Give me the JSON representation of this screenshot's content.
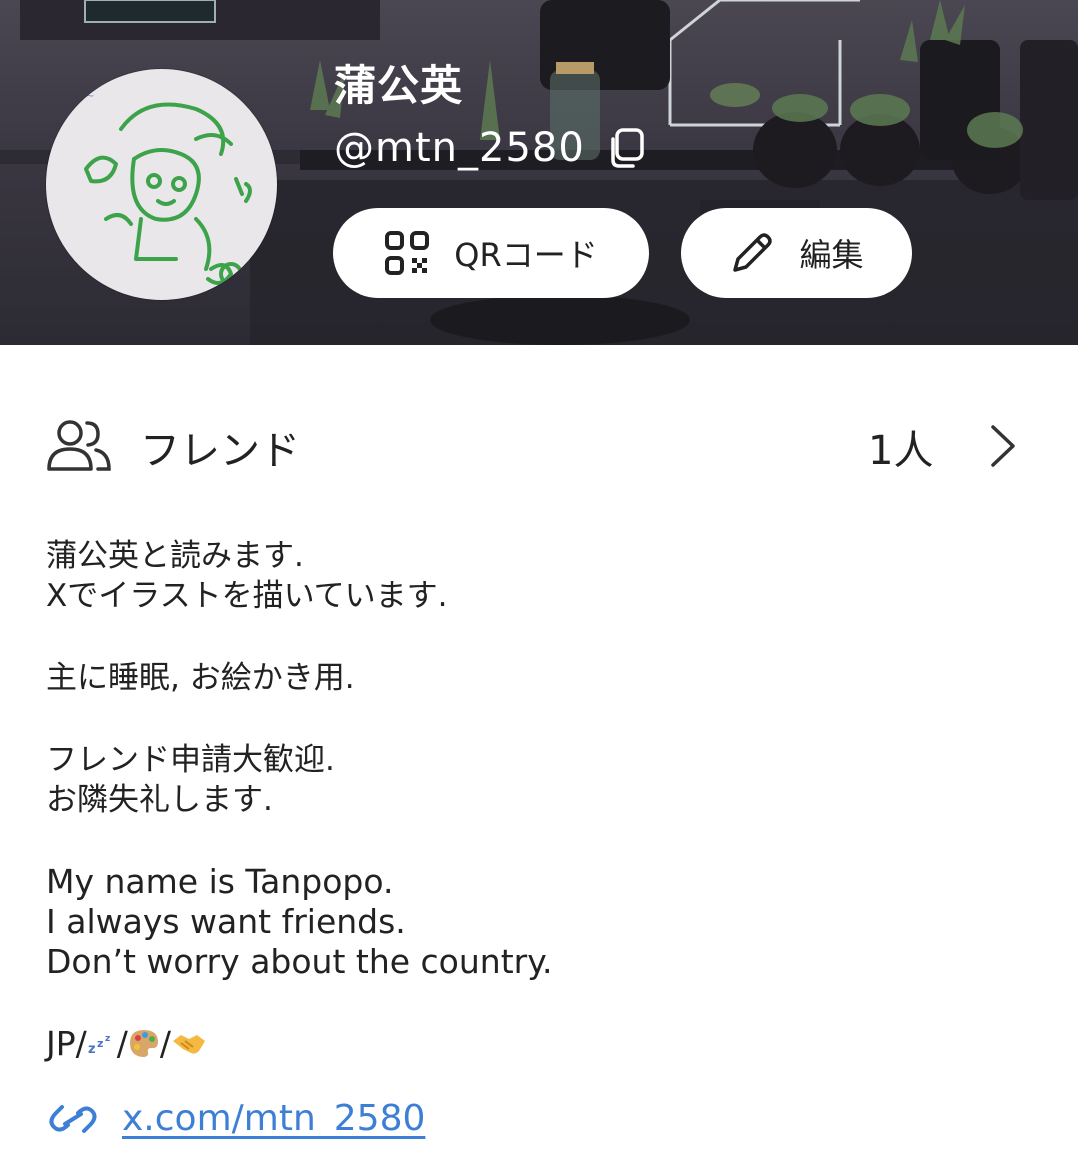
{
  "profile": {
    "display_name": "蒲公英",
    "handle": "@mtn_2580"
  },
  "actions": {
    "qr_label": "QRコード",
    "edit_label": "編集"
  },
  "friends": {
    "label": "フレンド",
    "count": "1人"
  },
  "bio": {
    "lines_ja_1": [
      "蒲公英と読みます.",
      "Xでイラストを描いています."
    ],
    "line_ja_2": "主に睡眠, お絵かき用.",
    "lines_ja_3": [
      "フレンド申請大歓迎.",
      "お隣失礼します."
    ],
    "lines_en": [
      "My name is Tanpopo.",
      "I always want friends.",
      "Don’t worry about the country."
    ],
    "tags_prefix": "JP/",
    "tag_icons": [
      "sleep-zzz-icon",
      "artist-palette-icon",
      "handshake-icon"
    ]
  },
  "link": {
    "text": "x.com/mtn_2580"
  },
  "colors": {
    "link": "#3e7fd6",
    "cover_dark": "#2c2a33",
    "pill_bg": "#ffffff"
  }
}
